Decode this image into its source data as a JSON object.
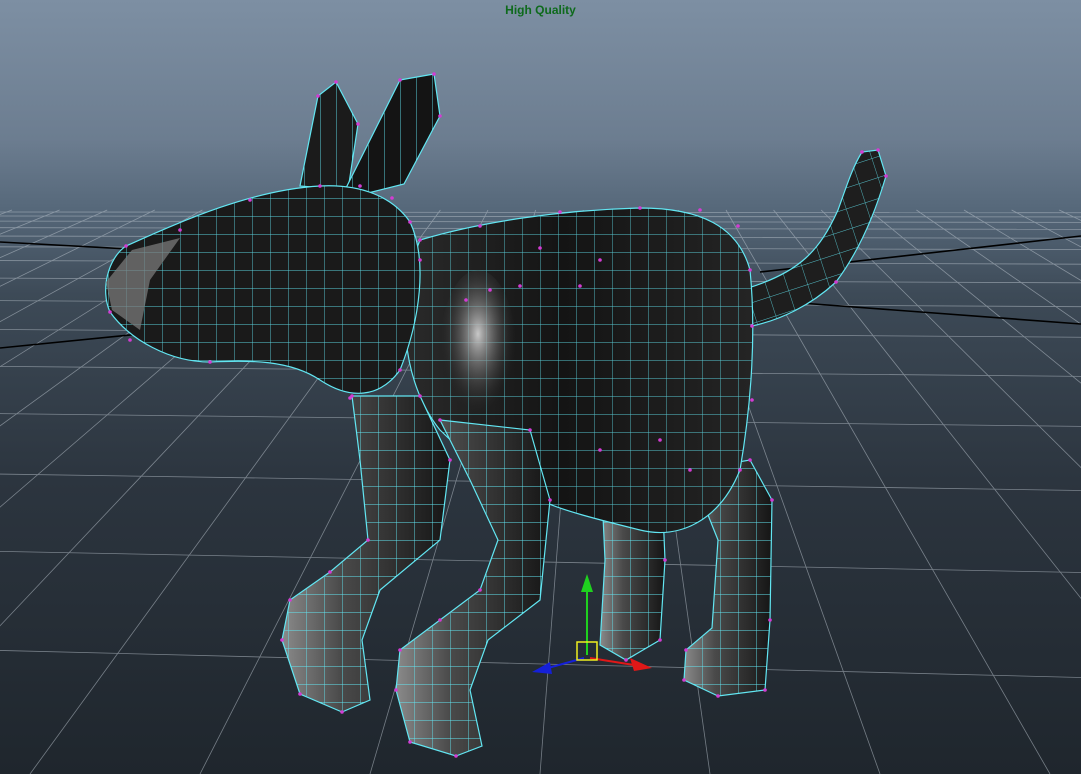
{
  "viewport": {
    "hud_label": "High Quality"
  },
  "scene": {
    "model": "low-poly-dog",
    "components": [
      "head",
      "ears",
      "body",
      "tail",
      "front-legs",
      "hind-legs"
    ],
    "display_mode": "smooth-shaded-with-wireframe",
    "wireframe_color": "#62e6f2",
    "vertex_color": "#d33cd3",
    "surface_color": "#1c1c1c",
    "grid_color": "#bac3cc",
    "axis_line_color": "#000000"
  },
  "manipulator": {
    "type": "move-tool",
    "axes": [
      {
        "axis": "y",
        "icon": "arrow-up-icon",
        "color": "#1fd11f"
      },
      {
        "axis": "x",
        "icon": "arrow-right-icon",
        "color": "#e01818"
      },
      {
        "axis": "z",
        "icon": "arrow-left-icon",
        "color": "#1520d8"
      }
    ],
    "center_handle_color": "#f0f020"
  }
}
